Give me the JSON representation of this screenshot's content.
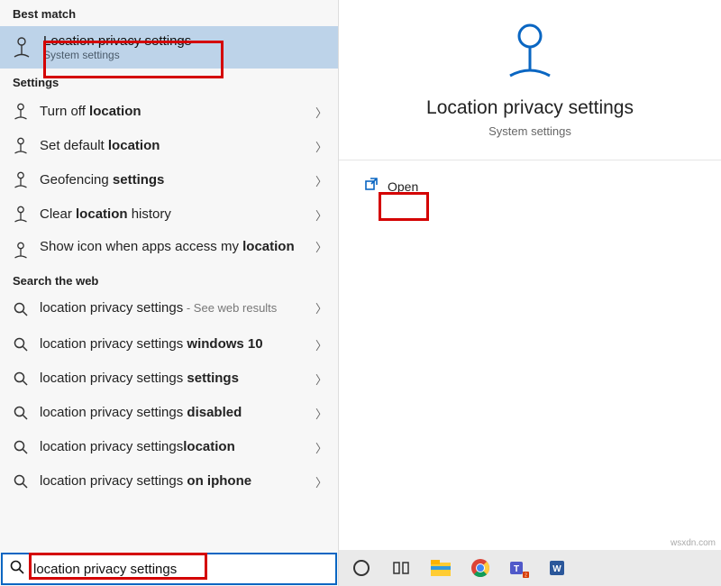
{
  "sidebar": {
    "best_match_header": "Best match",
    "best_match": {
      "title": "Location privacy settings",
      "subtitle": "System settings"
    },
    "settings_header": "Settings",
    "settings_items": [
      {
        "prefix": "Turn off ",
        "bold": "location"
      },
      {
        "prefix": "Set default ",
        "bold": "location"
      },
      {
        "prefix": "Geofencing ",
        "bold": "settings"
      },
      {
        "prefix": "Clear ",
        "bold": "location",
        "suffix": " history"
      },
      {
        "prefix": "Show icon when apps access my ",
        "bold": "location",
        "multiline": true
      }
    ],
    "web_header": "Search the web",
    "web_items": [
      {
        "text": "location privacy settings",
        "suffix": " - See web results",
        "multiline": true
      },
      {
        "text": "location privacy settings ",
        "bold": "windows 10"
      },
      {
        "text": "location privacy settings ",
        "bold": "settings"
      },
      {
        "text": "location privacy settings ",
        "bold": "disabled"
      },
      {
        "text": "location privacy settings",
        "bold": "location"
      },
      {
        "text": "location privacy settings ",
        "bold": "on iphone"
      }
    ],
    "search_query": "location privacy settings"
  },
  "detail": {
    "title": "Location privacy settings",
    "subtitle": "System settings",
    "open_label": "Open"
  },
  "taskbar": {
    "items": [
      "cortana-circle-icon",
      "task-view-icon",
      "file-explorer-icon",
      "chrome-icon",
      "teams-icon",
      "word-icon"
    ]
  },
  "watermark": "wsxdn.com",
  "colors": {
    "highlight": "#bdd3e9",
    "accent_blue": "#0a66c2",
    "red": "#d40000"
  }
}
